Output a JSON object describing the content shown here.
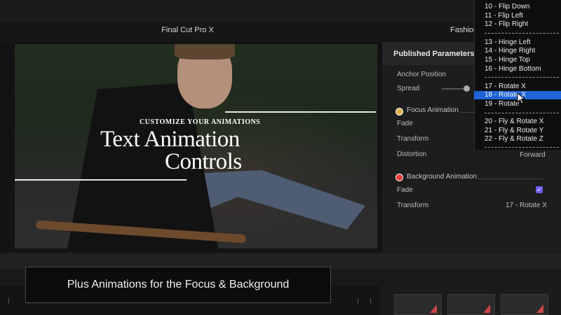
{
  "app": {
    "title": "Final Cut Pro X",
    "library_title": "Fashion"
  },
  "viewer": {
    "kicker": "CUSTOMIZE YOUR ANIMATIONS",
    "title_line1": "Text Animation",
    "title_line2": "Controls"
  },
  "inspector": {
    "header": "Published Parameters",
    "anchor_position_label": "Anchor Position",
    "spread_label": "Spread",
    "focus": {
      "label": "Focus Animation",
      "fade_label": "Fade",
      "transform_label": "Transform",
      "distortion_label": "Distortion",
      "distortion_value": "Forward"
    },
    "background": {
      "label": "Background Animation",
      "fade_label": "Fade",
      "fade_checked": true,
      "transform_label": "Transform",
      "transform_value": "17 - Rotate X"
    },
    "colors": {
      "accent": "#6f5cf0",
      "selection": "#1e64d6",
      "focus_icon": "#e0b24a",
      "background_icon": "#e23a3a"
    }
  },
  "dropdown": {
    "items": [
      "10 - Flip Down",
      "11 - Flip Left",
      "12 - Flip Right",
      "13 - Hinge Left",
      "14 - Hinge Right",
      "15 - Hinge Top",
      "16 - Hinge Bottom",
      "17 - Rotate X",
      "18 - Rotate X",
      "19 - Rotate",
      "20 - Fly & Rotate X",
      "21 - Fly & Rotate Y",
      "22 - Fly & Rotate Z"
    ],
    "selected": "18 - Rotate X"
  },
  "caption": "Plus Animations for the Focus & Background",
  "icons": {
    "cursor": "arrow-cursor-icon",
    "focus": "focus-animation-icon",
    "background": "background-animation-icon",
    "checkbox": "check-icon"
  }
}
